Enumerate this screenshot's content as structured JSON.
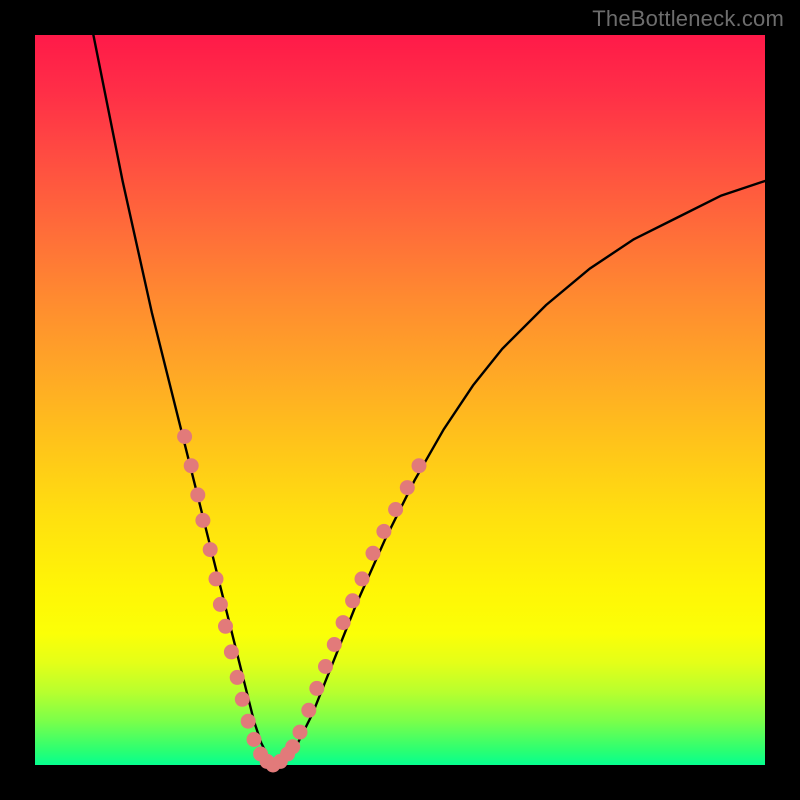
{
  "watermark": "TheBottleneck.com",
  "chart_data": {
    "type": "line",
    "title": "",
    "xlabel": "",
    "ylabel": "",
    "xlim": [
      0,
      100
    ],
    "ylim": [
      0,
      100
    ],
    "series": [
      {
        "name": "bottleneck-curve",
        "x": [
          8,
          10,
          12,
          14,
          16,
          18,
          20,
          22,
          24,
          26,
          27,
          28,
          29,
          30,
          31,
          32,
          33,
          34,
          36,
          38,
          40,
          44,
          48,
          52,
          56,
          60,
          64,
          70,
          76,
          82,
          88,
          94,
          100
        ],
        "y": [
          100,
          90,
          80,
          71,
          62,
          54,
          46,
          38,
          30,
          22,
          18,
          14,
          10,
          6,
          3,
          1,
          0,
          1,
          3,
          7,
          12,
          22,
          31,
          39,
          46,
          52,
          57,
          63,
          68,
          72,
          75,
          78,
          80
        ]
      }
    ],
    "markers": [
      {
        "name": "left-dots",
        "color": "#e27a7a",
        "points": [
          {
            "x": 20.5,
            "y": 45
          },
          {
            "x": 21.4,
            "y": 41
          },
          {
            "x": 22.3,
            "y": 37
          },
          {
            "x": 23.0,
            "y": 33.5
          },
          {
            "x": 24.0,
            "y": 29.5
          },
          {
            "x": 24.8,
            "y": 25.5
          },
          {
            "x": 25.4,
            "y": 22
          },
          {
            "x": 26.1,
            "y": 19
          },
          {
            "x": 26.9,
            "y": 15.5
          },
          {
            "x": 27.7,
            "y": 12
          },
          {
            "x": 28.4,
            "y": 9
          },
          {
            "x": 29.2,
            "y": 6
          },
          {
            "x": 30.0,
            "y": 3.5
          },
          {
            "x": 30.9,
            "y": 1.5
          },
          {
            "x": 31.8,
            "y": 0.5
          },
          {
            "x": 32.6,
            "y": 0
          },
          {
            "x": 33.6,
            "y": 0.5
          },
          {
            "x": 34.6,
            "y": 1.5
          }
        ]
      },
      {
        "name": "right-dots",
        "color": "#e27a7a",
        "points": [
          {
            "x": 35.3,
            "y": 2.5
          },
          {
            "x": 36.3,
            "y": 4.5
          },
          {
            "x": 37.5,
            "y": 7.5
          },
          {
            "x": 38.6,
            "y": 10.5
          },
          {
            "x": 39.8,
            "y": 13.5
          },
          {
            "x": 41.0,
            "y": 16.5
          },
          {
            "x": 42.2,
            "y": 19.5
          },
          {
            "x": 43.5,
            "y": 22.5
          },
          {
            "x": 44.8,
            "y": 25.5
          },
          {
            "x": 46.3,
            "y": 29
          },
          {
            "x": 47.8,
            "y": 32
          },
          {
            "x": 49.4,
            "y": 35
          },
          {
            "x": 51.0,
            "y": 38
          },
          {
            "x": 52.6,
            "y": 41
          }
        ]
      }
    ]
  }
}
